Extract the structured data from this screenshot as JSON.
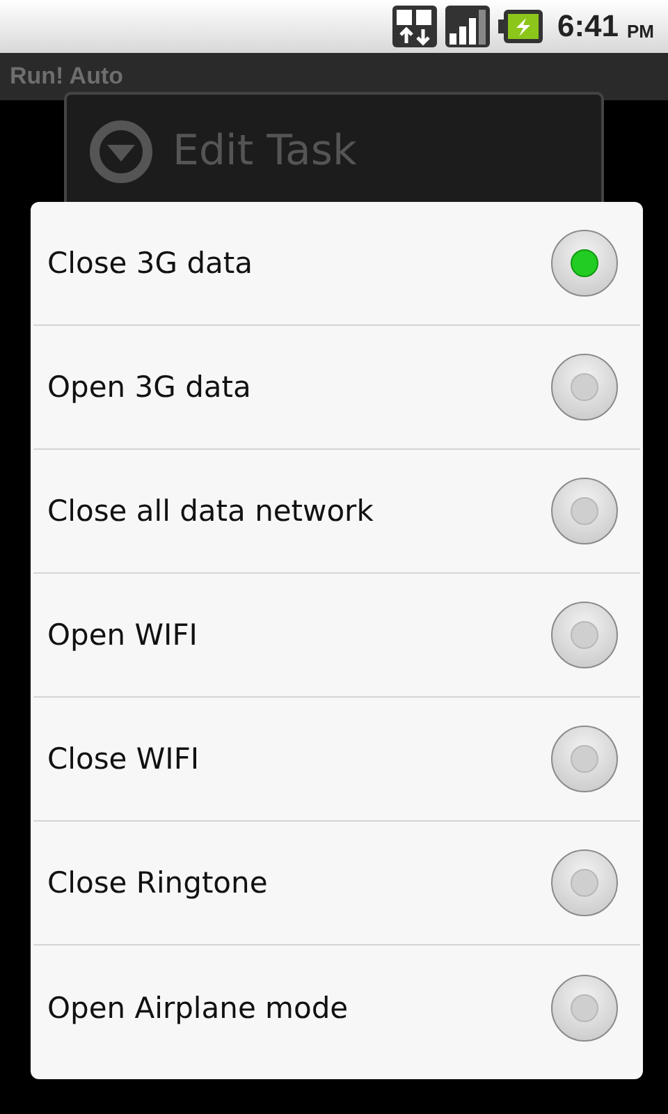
{
  "status_bar": {
    "time": "6:41",
    "ampm": "PM"
  },
  "app": {
    "title": "Run! Auto"
  },
  "background_dialog": {
    "title": "Edit Task"
  },
  "options": [
    {
      "label": "Close 3G data",
      "selected": true
    },
    {
      "label": "Open 3G data",
      "selected": false
    },
    {
      "label": "Close all data network",
      "selected": false
    },
    {
      "label": "Open WIFI",
      "selected": false
    },
    {
      "label": "Close WIFI",
      "selected": false
    },
    {
      "label": "Close Ringtone",
      "selected": false
    },
    {
      "label": "Open Airplane mode",
      "selected": false
    }
  ]
}
